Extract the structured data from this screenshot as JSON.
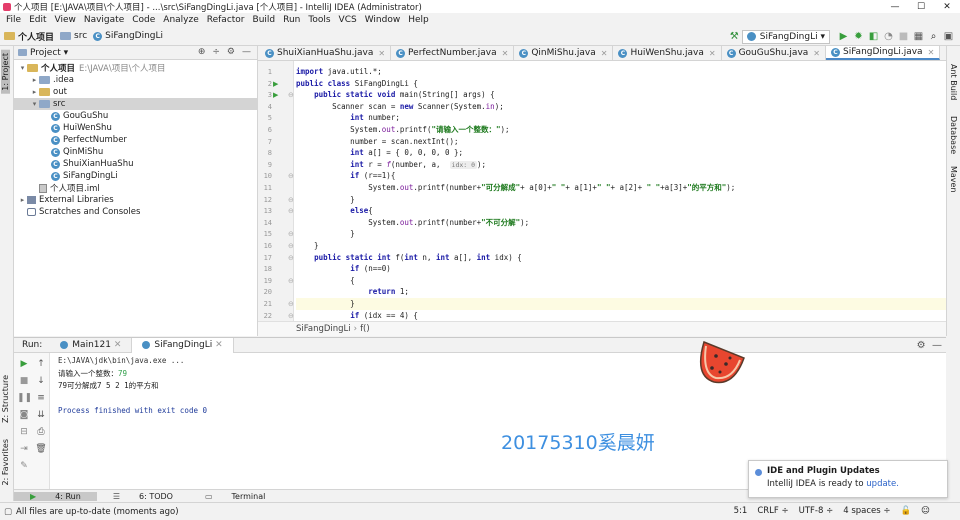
{
  "title": "个人项目 [E:\\JAVA\\项目\\个人项目] - ...\\src\\SiFangDingLi.java [个人项目] - IntelliJ IDEA (Administrator)",
  "menu": [
    "File",
    "Edit",
    "View",
    "Navigate",
    "Code",
    "Analyze",
    "Refactor",
    "Build",
    "Run",
    "Tools",
    "VCS",
    "Window",
    "Help"
  ],
  "breadcrumb": [
    "个人项目",
    "src",
    "SiFangDingLi"
  ],
  "run_config": "SiFangDingLi",
  "project": {
    "header": "Project",
    "nodes": [
      {
        "label": "个人项目",
        "path": "E:\\JAVA\\项目\\个人项目",
        "indent": 0,
        "arrow": "▾",
        "icon": "folder-yellow",
        "bold": true
      },
      {
        "label": ".idea",
        "indent": 1,
        "arrow": "▸",
        "icon": "folder"
      },
      {
        "label": "out",
        "indent": 1,
        "arrow": "▸",
        "icon": "folder-yellow"
      },
      {
        "label": "src",
        "indent": 1,
        "arrow": "▾",
        "icon": "folder",
        "sel": true
      },
      {
        "label": "GouGuShu",
        "indent": 2,
        "icon": "class"
      },
      {
        "label": "HuiWenShu",
        "indent": 2,
        "icon": "class"
      },
      {
        "label": "PerfectNumber",
        "indent": 2,
        "icon": "class"
      },
      {
        "label": "QinMiShu",
        "indent": 2,
        "icon": "class"
      },
      {
        "label": "ShuiXianHuaShu",
        "indent": 2,
        "icon": "class"
      },
      {
        "label": "SiFangDingLi",
        "indent": 2,
        "icon": "class"
      },
      {
        "label": "个人项目.iml",
        "indent": 1,
        "icon": "iml"
      },
      {
        "label": "External Libraries",
        "indent": 0,
        "arrow": "▸",
        "icon": "lib"
      },
      {
        "label": "Scratches and Consoles",
        "indent": 0,
        "icon": "scratch"
      }
    ]
  },
  "tabs": [
    {
      "label": "ShuiXianHuaShu.java"
    },
    {
      "label": "PerfectNumber.java"
    },
    {
      "label": "QinMiShu.java"
    },
    {
      "label": "HuiWenShu.java"
    },
    {
      "label": "GouGuShu.java"
    },
    {
      "label": "SiFangDingLi.java",
      "active": true
    }
  ],
  "code": [
    "<span class=\"kw\">import</span> java.util.*;",
    "<span class=\"kw\">public class</span> SiFangDingLi {",
    "    <span class=\"kw\">public static void</span> main(String[] args) {",
    "        Scanner scan = <span class=\"kw\">new</span> Scanner(System.<span class=\"fld\">in</span>);",
    "            <span class=\"kw\">int</span> number;",
    "            System.<span class=\"fld\">out</span>.printf(<span class=\"str\">\"请输入一个整数：\"</span>);",
    "            number = scan.nextInt();",
    "            <span class=\"kw\">int</span> a[] = { 0, 0, 0, 0 };",
    "            <span class=\"kw\">int</span> r = <span class=\"fn\">f</span>(number, a,  <span class=\"hint\">idx: 0</span>);",
    "            <span class=\"kw\">if</span> (r==1){",
    "                System.<span class=\"fld\">out</span>.printf(number+<span class=\"str\">\"可分解成\"</span>+ a[0]+<span class=\"str\">\" \"</span>+ a[1]+<span class=\"str\">\" \"</span>+ a[2]+ <span class=\"str\">\" \"</span>+a[3]+<span class=\"str\">\"的平方和\"</span>);",
    "            }",
    "            <span class=\"kw\">else</span>{",
    "                System.<span class=\"fld\">out</span>.printf(number+<span class=\"str\">\"不可分解\"</span>);",
    "            }",
    "    }",
    "    <span class=\"kw\">public static int</span> f(<span class=\"kw\">int</span> n, <span class=\"kw\">int</span> a[], <span class=\"kw\">int</span> idx) {",
    "            <span class=\"kw\">if</span> (n==0)",
    "            {",
    "                <span class=\"kw\">return</span> 1;",
    "            }",
    "            <span class=\"kw\">if</span> (idx == 4) {",
    "                <span class=\"kw\">return</span> 0;"
  ],
  "line_numbers": [
    "1",
    "2",
    "3",
    "4",
    "5",
    "6",
    "7",
    "8",
    "9",
    "10",
    "11",
    "12",
    "13",
    "14",
    "15",
    "16",
    "17",
    "18",
    "19",
    "20",
    "21",
    "22",
    "23"
  ],
  "editor_crumb": [
    "SiFangDingLi",
    "f()"
  ],
  "run": {
    "label": "Run:",
    "tabs": [
      "Main121",
      "SiFangDingLi"
    ],
    "console": [
      {
        "text": "E:\\JAVA\\jdk\\bin\\java.exe ...",
        "cls": "c-path"
      },
      {
        "text": "请输入一个整数：",
        "cls": "c-out",
        "input": "79"
      },
      {
        "text": "79可分解成7 5 2 1的平方和",
        "cls": "c-out"
      },
      {
        "text": "",
        "cls": "c-out"
      },
      {
        "text": "Process finished with exit code 0",
        "cls": "c-done"
      }
    ],
    "watermark": "20175310奚晨妍"
  },
  "bottom_tabs": [
    "4: Run",
    "6: TODO",
    "Terminal"
  ],
  "status": {
    "message": "All files are up-to-date (moments ago)",
    "position": "5:1",
    "line_sep": "CRLF ÷",
    "encoding": "UTF-8 ÷",
    "indent": "4 spaces ÷"
  },
  "notification": {
    "title": "IDE and Plugin Updates",
    "body": "IntelliJ IDEA is ready to ",
    "link": "update."
  },
  "side_tabs": {
    "left_top": "1: Project",
    "left_structure": "Z: Structure",
    "left_fav": "2: Favorites",
    "right": [
      "Ant Build",
      "Database",
      "Maven"
    ]
  }
}
